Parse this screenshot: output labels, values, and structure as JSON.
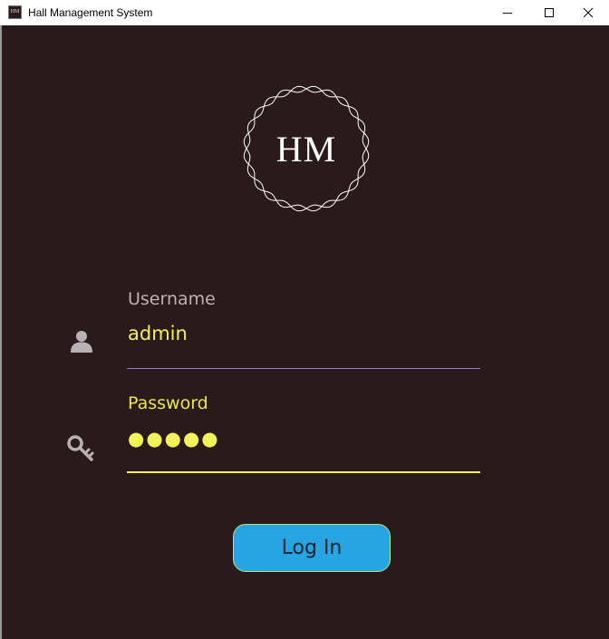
{
  "window": {
    "title": "Hall Management System",
    "app_icon_text": "HM",
    "controls": {
      "minimize": "minimize-icon",
      "maximize": "maximize-icon",
      "close": "close-icon"
    }
  },
  "logo": {
    "text": "HM"
  },
  "username": {
    "label": "Username",
    "value": "admin",
    "icon": "user-icon"
  },
  "password": {
    "label": "Password",
    "value": "●●●●●",
    "icon": "key-icon"
  },
  "login_button": {
    "label": "Log In"
  },
  "colors": {
    "background": "#2a1a1b",
    "value_text": "#f2f25a",
    "active_label": "#e8e84a",
    "inactive_label": "#bcb2b6",
    "username_underline": "#8d7bd0",
    "button": "#27a4e2",
    "button_border": "#b9e27a"
  }
}
